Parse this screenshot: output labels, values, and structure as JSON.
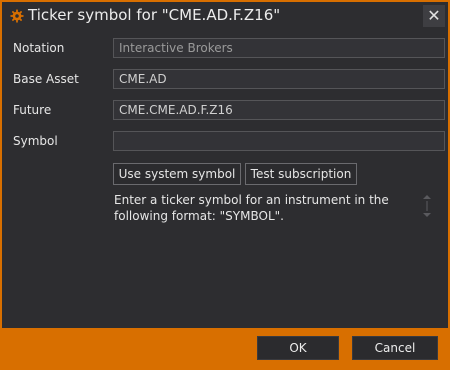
{
  "window": {
    "title": "Ticker symbol for \"CME.AD.F.Z16\"",
    "accent_color": "#d86f00",
    "icon": "gear-icon",
    "close_glyph": "✕"
  },
  "form": {
    "notation": {
      "label": "Notation",
      "value": "Interactive Brokers"
    },
    "base_asset": {
      "label": "Base Asset",
      "value": "CME.AD"
    },
    "future": {
      "label": "Future",
      "value": "CME.CME.AD.F.Z16"
    },
    "symbol": {
      "label": "Symbol",
      "value": ""
    }
  },
  "actions": {
    "use_system_symbol": "Use system symbol",
    "test_subscription": "Test subscription"
  },
  "help_text": "Enter a ticker symbol for an instrument in the following format: \"SYMBOL\".",
  "footer": {
    "ok": "OK",
    "cancel": "Cancel"
  }
}
